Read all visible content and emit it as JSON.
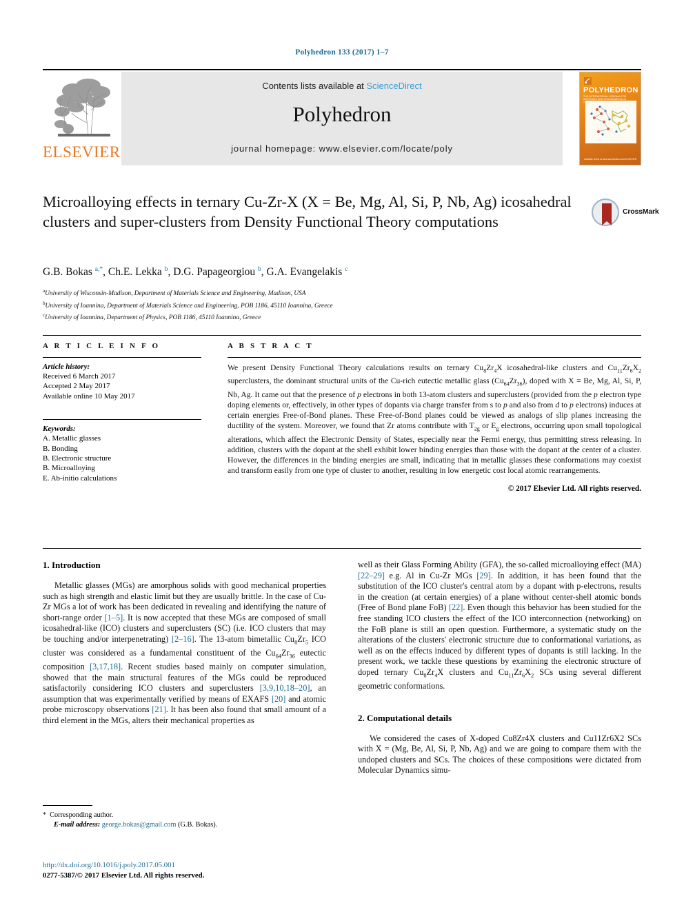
{
  "running_head": "Polyhedron 133 (2017) 1–7",
  "masthead": {
    "contents_prefix": "Contents lists available at ",
    "contents_link": "ScienceDirect",
    "journal_name": "Polyhedron",
    "homepage": "journal homepage: www.elsevier.com/locate/poly",
    "publisher_logo_text": "ELSEVIER",
    "cover": {
      "title": "POLYHEDRON",
      "subtitle": "THE INTERNATIONAL JOURNAL FOR INORGANIC AND ORGANOMETALLIC CHEMISTRY",
      "bottom_left": "Available online at\nwww.sciencedirect.com",
      "bottom_right": "ELSEVIER"
    }
  },
  "article": {
    "title": "Microalloying effects in ternary Cu-Zr-X (X = Be, Mg, Al, Si, P, Nb, Ag) icosahedral clusters and super-clusters from Density Functional Theory computations",
    "crossmark_label": "CrossMark",
    "authors_html": "G.B. Bokas <sup>a,*</sup>, Ch.E. Lekka <sup>b</sup>, D.G. Papageorgiou <sup>b</sup>, G.A. Evangelakis <sup>c</sup>",
    "affiliations": [
      {
        "marker": "a",
        "text": "University of Wisconsin-Madison, Department of Materials Science and Engineering, Madison, USA"
      },
      {
        "marker": "b",
        "text": "University of Ioannina, Department of Materials Science and Engineering, POB 1186, 45110 Ioannina, Greece"
      },
      {
        "marker": "c",
        "text": "University of Ioannina, Department of Physics, POB 1186, 45110 Ioannina, Greece"
      }
    ]
  },
  "article_info": {
    "heading": "A R T I C L E   I N F O",
    "history_label": "Article history:",
    "history": [
      "Received 6 March 2017",
      "Accepted 2 May 2017",
      "Available online 10 May 2017"
    ],
    "keywords_label": "Keywords:",
    "keywords": [
      "A. Metallic glasses",
      "B. Bonding",
      "B. Electronic structure",
      "B. Microalloying",
      "E. Ab-initio calculations"
    ]
  },
  "abstract": {
    "heading": "A B S T R A C T",
    "body_html": "We present Density Functional Theory calculations results on ternary Cu<sub>8</sub>Zr<sub>4</sub>X icosahedral-like clusters and Cu<sub>11</sub>Zr<sub>6</sub>X<sub>2</sub> superclusters, the dominant structural units of the Cu-rich eutectic metallic glass (Cu<sub>64</sub>Zr<sub>36</sub>), doped with X&nbsp;=&nbsp;Be, Mg, Al, Si, P, Nb, Ag. It came out that the presence of <i>p</i> electrons in both 13-atom clusters and superclusters (provided from the <i>p</i> electron type doping elements or, effectively, in other types of dopants via charge transfer from s to <i>p</i> and also from <i>d</i> to <i>p</i> electrons) induces at certain energies Free-of-Bond planes. These Free-of-Bond planes could be viewed as analogs of slip planes increasing the ductility of the system. Moreover, we found that Zr atoms contribute with T<sub>2g</sub> or E<sub>g</sub> electrons, occurring upon small topological alterations, which affect the Electronic Density of States, especially near the Fermi energy, thus permitting stress releasing. In addition, clusters with the dopant at the shell exhibit lower binding energies than those with the dopant at the center of a cluster. However, the differences in the binding energies are small, indicating that in metallic glasses these conformations may coexist and transform easily from one type of cluster to another, resulting in low energetic cost local atomic rearrangements.",
    "copyright": "© 2017 Elsevier Ltd. All rights reserved."
  },
  "sections": {
    "intro_heading": "1. Introduction",
    "intro_p1_html": "Metallic glasses (MGs) are amorphous solids with good mechanical properties such as high strength and elastic limit but they are usually brittle. In the case of Cu-Zr MGs a lot of work has been dedicated in revealing and identifying the nature of short-range order <span class=\"ref\">[1–5]</span>. It is now accepted that these MGs are composed of small icosahedral-like (ICO) clusters and superclusters (SC) (i.e. ICO clusters that may be touching and/or interpenetrating) <span class=\"ref\">[2–16]</span>. The 13-atom bimetallic Cu<sub>8</sub>Zr<sub>5</sub> ICO cluster was considered as a fundamental constituent of the Cu<sub>64</sub>Zr<sub>36</sub> eutectic composition <span class=\"ref\">[3,17,18]</span>. Recent studies based mainly on computer simulation, showed that the main structural features of the MGs could be reproduced satisfactorily considering ICO clusters and superclusters <span class=\"ref\">[3,9,10,18–20]</span>, an assumption that was experimentally verified by means of EXAFS <span class=\"ref\">[20]</span> and atomic probe microscopy observations <span class=\"ref\">[21]</span>. It has been also found that small amount of a third element in the MGs, alters their mechanical properties as",
    "intro_p1_cont_html": "well as their Glass Forming Ability (GFA), the so-called microalloying effect (MA) <span class=\"ref\">[22–29]</span> e.g. Al in Cu-Zr MGs <span class=\"ref\">[29]</span>. In addition, it has been found that the substitution of the ICO cluster's central atom by a dopant with p-electrons, results in the creation (at certain energies) of a plane without center-shell atomic bonds (Free of Bond plane FoB) <span class=\"ref\">[22]</span>. Even though this behavior has been studied for the free standing ICO clusters the effect of the ICO interconnection (networking) on the FoB plane is still an open question. Furthermore, a systematic study on the alterations of the clusters' electronic structure due to conformational variations, as well as on the effects induced by different types of dopants is still lacking. In the present work, we tackle these questions by examining the electronic structure of doped ternary Cu<sub>8</sub>Zr<sub>4</sub>X clusters and Cu<sub>11</sub>Zr<sub>6</sub>X<sub>2</sub> SCs using several different geometric conformations.",
    "comp_heading": "2. Computational details",
    "comp_p1_html": "We considered the cases of X-doped Cu8Zr4X clusters and Cu11Zr6X2 SCs with X = (Mg, Be, Al, Si, P, Nb, Ag) and we are going to compare them with the undoped clusters and SCs. The choices of these compositions were dictated from Molecular Dynamics simu-"
  },
  "footnote": {
    "star": "*",
    "corresponding": "Corresponding author.",
    "email_label": "E-mail address:",
    "email": "george.bokas@gmail.com",
    "email_owner": "(G.B. Bokas)."
  },
  "bottom": {
    "doi": "http://dx.doi.org/10.1016/j.poly.2017.05.001",
    "issn": "0277-5387/© 2017 Elsevier Ltd. All rights reserved."
  },
  "colors": {
    "link": "#1b6a93",
    "sciencedirect": "#3a9ed0",
    "elsevier_orange": "#e87722",
    "band": "#e7e7e7"
  }
}
